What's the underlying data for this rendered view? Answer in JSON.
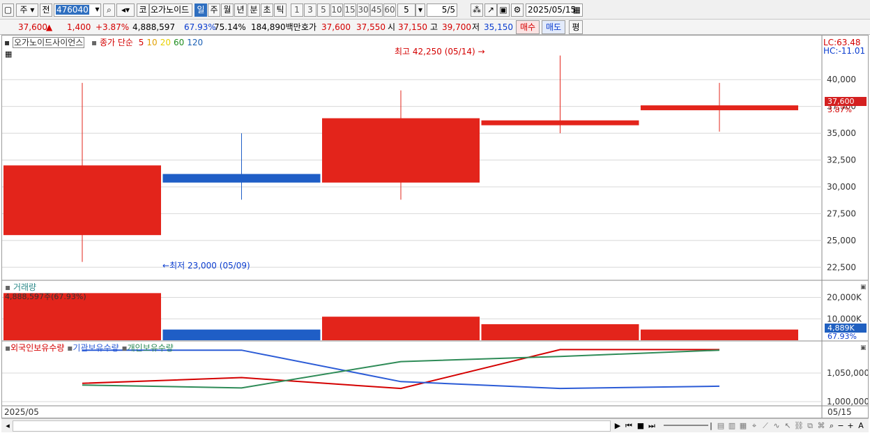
{
  "toolbar": {
    "period_type": "주",
    "prev_label": "전",
    "code": "476040",
    "market_badge": "코",
    "stock_name": "오가노이드",
    "periods": [
      "일",
      "주",
      "월",
      "년",
      "분",
      "초",
      "틱"
    ],
    "active_period": "일",
    "minutes": [
      "1",
      "3",
      "5",
      "10",
      "15",
      "30",
      "45",
      "60"
    ],
    "count_value": "5",
    "page": "5/5",
    "date": "2025/05/15"
  },
  "quote": {
    "price": "37,600",
    "arrow": "▲",
    "change": "1,400",
    "change_pct": "+3.87%",
    "volume": "4,888,597",
    "volume_ratio": "67.93%",
    "turnover": "75.14%",
    "amount": "184,890백만",
    "ask_label": "호가",
    "ask1": "37,600",
    "ask2": "37,550",
    "open_label": "시",
    "open": "37,150",
    "high_label": "고",
    "high": "39,700",
    "low_label": "저",
    "low": "35,150",
    "buy_label": "매수",
    "sell_label": "매도",
    "avg_label": "평"
  },
  "price_panel": {
    "stock_label": "오가노이드사이언스",
    "ma_label": "종가 단순",
    "ma_periods": [
      "5",
      "10",
      "20",
      "60",
      "120"
    ],
    "ma_colors": [
      "#d40000",
      "#e0a000",
      "#e8d000",
      "#1e8c1e",
      "#1a5fb4"
    ],
    "lc": "LC:63.48",
    "hc": "HC:-11.01",
    "high_annotation": "최고 42,250 (05/14)",
    "low_annotation": "최저 23,000 (05/09)",
    "current_price_tag": "37,600",
    "current_pct_tag": "3.87%",
    "yticks": [
      "40,000",
      "37,500",
      "35,000",
      "32,500",
      "30,000",
      "27,500",
      "25,000",
      "22,500"
    ]
  },
  "volume_panel": {
    "title": "거래량",
    "readout": "4,888,597주(67.93%)",
    "yticks": [
      "20,000K",
      "10,000K"
    ],
    "current_tag": "4,889K",
    "current_pct": "67.93%"
  },
  "holdings_panel": {
    "legend": [
      "외국인보유수량",
      "기관보유수량",
      "개인보유수량"
    ],
    "colors": [
      "#d40000",
      "#2b5bd6",
      "#2e8b57"
    ],
    "yticks": [
      "1,050,000",
      "1,000,000"
    ]
  },
  "xaxis": {
    "left": "2025/05",
    "right": "05/15"
  },
  "chart_data": {
    "type": "candlestick",
    "candles": [
      {
        "open": 25500,
        "close": 32000,
        "high": 39700,
        "low": 23000,
        "dir": "up"
      },
      {
        "open": 31200,
        "close": 30400,
        "high": 35000,
        "low": 28800,
        "dir": "down"
      },
      {
        "open": 30400,
        "close": 36400,
        "high": 39000,
        "low": 28800,
        "dir": "up"
      },
      {
        "open": 36100,
        "close": 36200,
        "high": 42250,
        "low": 35000,
        "dir": "up"
      },
      {
        "open": 37150,
        "close": 37600,
        "high": 39700,
        "low": 35150,
        "dir": "up"
      }
    ],
    "ylim": [
      22000,
      43200
    ],
    "volumes_k": [
      22000,
      5000,
      11000,
      7500,
      5000
    ],
    "volume_ylim": [
      0,
      27000
    ],
    "holdings": {
      "foreign": [
        1032000,
        1042000,
        1023000,
        1091000,
        1091000
      ],
      "institution": [
        1090000,
        1090000,
        1035000,
        1023000,
        1027000
      ],
      "individual": [
        1029000,
        1024000,
        1070000,
        1079000,
        1090000
      ]
    },
    "holdings_ylim": [
      1000000,
      1100000
    ]
  }
}
